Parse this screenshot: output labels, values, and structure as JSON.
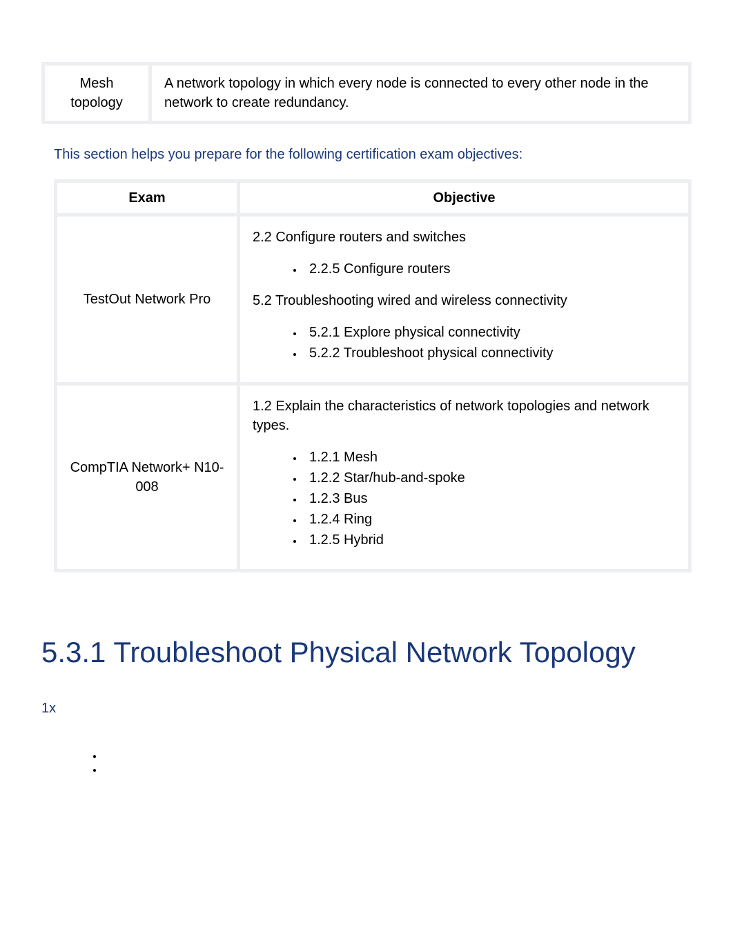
{
  "definition": {
    "term_line1": "Mesh",
    "term_line2": "topology",
    "desc": "A network topology in which every node is connected to every other node in the network to create redundancy."
  },
  "intro": "This section helps you prepare for the following certification exam objectives:",
  "columns": {
    "exam": "Exam",
    "objective": "Objective"
  },
  "rows": [
    {
      "exam": "TestOut Network Pro",
      "sections": [
        {
          "title": "2.2 Configure routers and switches",
          "items": [
            "2.2.5 Configure routers"
          ]
        },
        {
          "title": "5.2 Troubleshooting wired and wireless connectivity",
          "items": [
            "5.2.1 Explore physical connectivity",
            "5.2.2 Troubleshoot physical connectivity"
          ]
        }
      ]
    },
    {
      "exam": "CompTIA Network+ N10-008",
      "sections": [
        {
          "title": "1.2 Explain the characteristics of network topologies and network types.",
          "items": [
            "1.2.1 Mesh",
            "1.2.2 Star/hub-and-spoke",
            "1.2.3 Bus",
            "1.2.4 Ring",
            "1.2.5 Hybrid"
          ]
        }
      ]
    }
  ],
  "heading": "5.3.1 Troubleshoot Physical Network Topology",
  "speed": "1x"
}
